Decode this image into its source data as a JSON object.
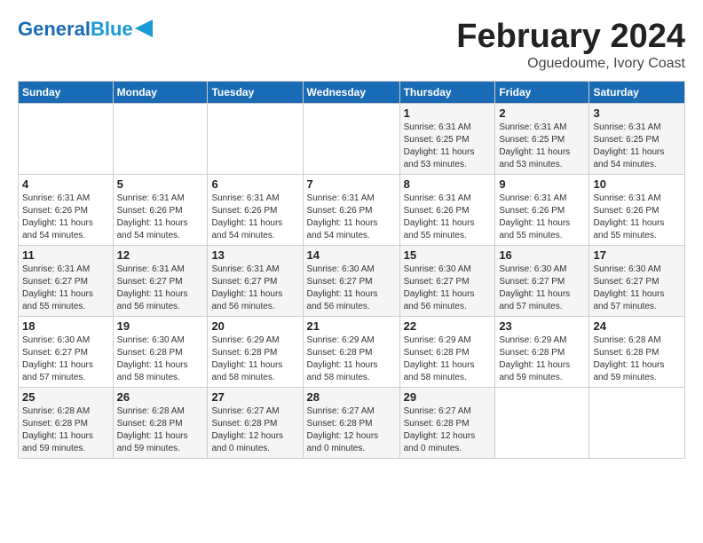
{
  "logo": {
    "part1": "General",
    "part2": "Blue"
  },
  "title": {
    "month": "February 2024",
    "location": "Oguedoume, Ivory Coast"
  },
  "header": {
    "days": [
      "Sunday",
      "Monday",
      "Tuesday",
      "Wednesday",
      "Thursday",
      "Friday",
      "Saturday"
    ]
  },
  "weeks": [
    [
      {
        "num": "",
        "info": ""
      },
      {
        "num": "",
        "info": ""
      },
      {
        "num": "",
        "info": ""
      },
      {
        "num": "",
        "info": ""
      },
      {
        "num": "1",
        "info": "Sunrise: 6:31 AM\nSunset: 6:25 PM\nDaylight: 11 hours\nand 53 minutes."
      },
      {
        "num": "2",
        "info": "Sunrise: 6:31 AM\nSunset: 6:25 PM\nDaylight: 11 hours\nand 53 minutes."
      },
      {
        "num": "3",
        "info": "Sunrise: 6:31 AM\nSunset: 6:25 PM\nDaylight: 11 hours\nand 54 minutes."
      }
    ],
    [
      {
        "num": "4",
        "info": "Sunrise: 6:31 AM\nSunset: 6:26 PM\nDaylight: 11 hours\nand 54 minutes."
      },
      {
        "num": "5",
        "info": "Sunrise: 6:31 AM\nSunset: 6:26 PM\nDaylight: 11 hours\nand 54 minutes."
      },
      {
        "num": "6",
        "info": "Sunrise: 6:31 AM\nSunset: 6:26 PM\nDaylight: 11 hours\nand 54 minutes."
      },
      {
        "num": "7",
        "info": "Sunrise: 6:31 AM\nSunset: 6:26 PM\nDaylight: 11 hours\nand 54 minutes."
      },
      {
        "num": "8",
        "info": "Sunrise: 6:31 AM\nSunset: 6:26 PM\nDaylight: 11 hours\nand 55 minutes."
      },
      {
        "num": "9",
        "info": "Sunrise: 6:31 AM\nSunset: 6:26 PM\nDaylight: 11 hours\nand 55 minutes."
      },
      {
        "num": "10",
        "info": "Sunrise: 6:31 AM\nSunset: 6:26 PM\nDaylight: 11 hours\nand 55 minutes."
      }
    ],
    [
      {
        "num": "11",
        "info": "Sunrise: 6:31 AM\nSunset: 6:27 PM\nDaylight: 11 hours\nand 55 minutes."
      },
      {
        "num": "12",
        "info": "Sunrise: 6:31 AM\nSunset: 6:27 PM\nDaylight: 11 hours\nand 56 minutes."
      },
      {
        "num": "13",
        "info": "Sunrise: 6:31 AM\nSunset: 6:27 PM\nDaylight: 11 hours\nand 56 minutes."
      },
      {
        "num": "14",
        "info": "Sunrise: 6:30 AM\nSunset: 6:27 PM\nDaylight: 11 hours\nand 56 minutes."
      },
      {
        "num": "15",
        "info": "Sunrise: 6:30 AM\nSunset: 6:27 PM\nDaylight: 11 hours\nand 56 minutes."
      },
      {
        "num": "16",
        "info": "Sunrise: 6:30 AM\nSunset: 6:27 PM\nDaylight: 11 hours\nand 57 minutes."
      },
      {
        "num": "17",
        "info": "Sunrise: 6:30 AM\nSunset: 6:27 PM\nDaylight: 11 hours\nand 57 minutes."
      }
    ],
    [
      {
        "num": "18",
        "info": "Sunrise: 6:30 AM\nSunset: 6:27 PM\nDaylight: 11 hours\nand 57 minutes."
      },
      {
        "num": "19",
        "info": "Sunrise: 6:30 AM\nSunset: 6:28 PM\nDaylight: 11 hours\nand 58 minutes."
      },
      {
        "num": "20",
        "info": "Sunrise: 6:29 AM\nSunset: 6:28 PM\nDaylight: 11 hours\nand 58 minutes."
      },
      {
        "num": "21",
        "info": "Sunrise: 6:29 AM\nSunset: 6:28 PM\nDaylight: 11 hours\nand 58 minutes."
      },
      {
        "num": "22",
        "info": "Sunrise: 6:29 AM\nSunset: 6:28 PM\nDaylight: 11 hours\nand 58 minutes."
      },
      {
        "num": "23",
        "info": "Sunrise: 6:29 AM\nSunset: 6:28 PM\nDaylight: 11 hours\nand 59 minutes."
      },
      {
        "num": "24",
        "info": "Sunrise: 6:28 AM\nSunset: 6:28 PM\nDaylight: 11 hours\nand 59 minutes."
      }
    ],
    [
      {
        "num": "25",
        "info": "Sunrise: 6:28 AM\nSunset: 6:28 PM\nDaylight: 11 hours\nand 59 minutes."
      },
      {
        "num": "26",
        "info": "Sunrise: 6:28 AM\nSunset: 6:28 PM\nDaylight: 11 hours\nand 59 minutes."
      },
      {
        "num": "27",
        "info": "Sunrise: 6:27 AM\nSunset: 6:28 PM\nDaylight: 12 hours\nand 0 minutes."
      },
      {
        "num": "28",
        "info": "Sunrise: 6:27 AM\nSunset: 6:28 PM\nDaylight: 12 hours\nand 0 minutes."
      },
      {
        "num": "29",
        "info": "Sunrise: 6:27 AM\nSunset: 6:28 PM\nDaylight: 12 hours\nand 0 minutes."
      },
      {
        "num": "",
        "info": ""
      },
      {
        "num": "",
        "info": ""
      }
    ]
  ]
}
